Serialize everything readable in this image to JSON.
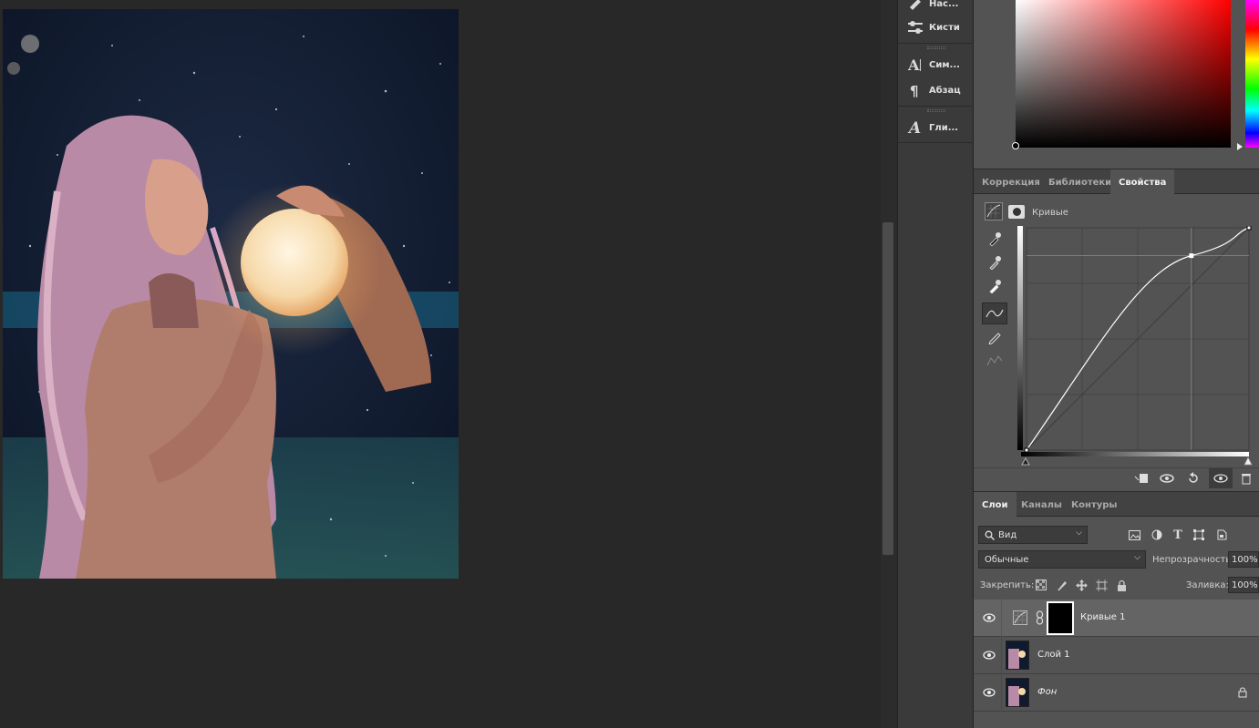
{
  "dock": {
    "items": [
      {
        "label": "Нас...",
        "icon": "brush-presets-icon"
      },
      {
        "label": "Кисти",
        "icon": "brush-settings-icon"
      },
      {
        "label": "Сим...",
        "icon": "character-icon"
      },
      {
        "label": "Абзац",
        "icon": "paragraph-icon"
      },
      {
        "label": "Гли...",
        "icon": "glyphs-icon"
      }
    ]
  },
  "upper_tabs": {
    "items": [
      "Коррекция",
      "Библиотеки",
      "Свойства"
    ],
    "active": 2
  },
  "properties": {
    "title": "Кривые",
    "curve_point": {
      "input": 189,
      "output": 223
    }
  },
  "layers_tabs": {
    "items": [
      "Слои",
      "Каналы",
      "Контуры"
    ],
    "active": 0
  },
  "layers": {
    "filter_label": "Вид",
    "blend_mode": "Обычные",
    "opacity_label": "Непрозрачность:",
    "opacity_value": "100%",
    "lock_label": "Закрепить:",
    "fill_label": "Заливка:",
    "fill_value": "100%",
    "rows": [
      {
        "name": "Кривые 1",
        "type": "adjustment",
        "selected": true
      },
      {
        "name": "Слой 1",
        "type": "pixel",
        "selected": false
      },
      {
        "name": "Фон",
        "type": "background",
        "selected": false,
        "italic": true,
        "locked": true
      }
    ]
  },
  "colors": {
    "panel": "#535353",
    "dark": "#282828",
    "dock": "#3a3a3a",
    "selected_layer": "#646464"
  }
}
